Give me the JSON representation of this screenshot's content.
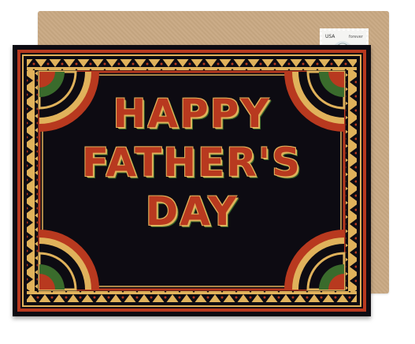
{
  "card": {
    "message_lines": [
      "HAPPY",
      "FATHER'S",
      "DAY"
    ]
  },
  "stamp": {
    "country": "USA",
    "denomination": "forever"
  },
  "colors": {
    "card_background": "#0d0b12",
    "pattern_red": "#b8391f",
    "pattern_gold": "#e0b25b",
    "pattern_green": "#3a6b2c",
    "envelope": "#c9a983"
  }
}
